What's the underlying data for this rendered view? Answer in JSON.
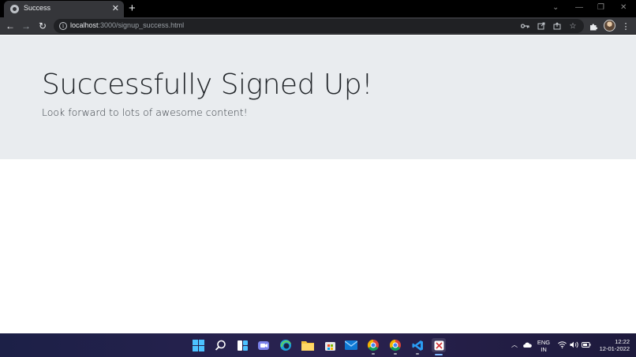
{
  "browser": {
    "tab": {
      "title": "Success",
      "close_glyph": "✕"
    },
    "new_tab_glyph": "+",
    "window_controls": {
      "collapse": "⌄",
      "minimize": "—",
      "restore": "❐",
      "close": "✕"
    },
    "nav": {
      "back": "←",
      "forward": "→",
      "reload": "↻"
    },
    "address": {
      "host": "localhost",
      "path": ":3000/signup_success.html"
    },
    "omnibox_icons": [
      "key-icon",
      "open-external-icon",
      "share-icon",
      "star-icon"
    ],
    "toolbar_icons": [
      "extensions-icon",
      "avatar",
      "menu-icon"
    ]
  },
  "page": {
    "heading": "Successfully Signed Up!",
    "lead": "Look forward to lots of awesome content!",
    "jumbotron_color": "#e9ecef"
  },
  "taskbar": {
    "apps": [
      "windows-start-icon",
      "search-icon",
      "widgets-icon",
      "teams-chat-icon",
      "edge-icon",
      "file-explorer-icon",
      "store-icon",
      "mail-icon",
      "chrome-icon",
      "chrome-profile-icon",
      "vscode-icon",
      "snipping-tool-icon"
    ],
    "tray": {
      "language_line1": "ENG",
      "language_line2": "IN",
      "time": "12:22",
      "date": "12-01-2022"
    }
  }
}
